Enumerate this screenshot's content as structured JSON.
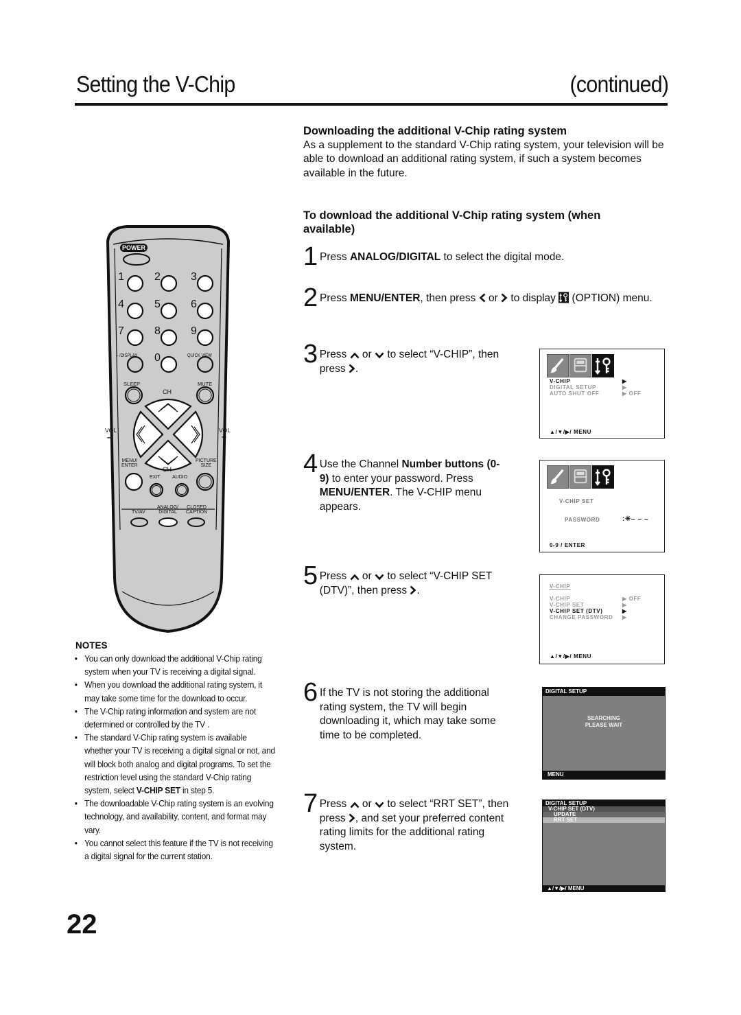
{
  "header": {
    "title": "Setting the V-Chip",
    "continued": "(continued)"
  },
  "section": {
    "heading": "Downloading the additional V-Chip rating system",
    "intro": "As a supplement to the standard V-Chip rating system, your television will be able to download an additional rating system, if such a system becomes available in the future.",
    "subheading": "To download the additional V-Chip rating system (when available)"
  },
  "steps": [
    {
      "num": "1",
      "parts": [
        "Press ",
        "ANALOG/DIGITAL",
        " to select the digital mode."
      ]
    },
    {
      "num": "2",
      "parts": [
        "Press ",
        "MENU/ENTER",
        ", then press ",
        " or ",
        " to display ",
        " (OPTION) menu."
      ]
    },
    {
      "num": "3",
      "parts": [
        "Press ",
        " or ",
        " to select “V-CHIP”, then press ",
        "."
      ]
    },
    {
      "num": "4",
      "parts": [
        "Use the Channel ",
        "Number buttons (0-9)",
        " to enter your password. Press ",
        "MENU/ENTER",
        ". The V-CHIP menu appears."
      ]
    },
    {
      "num": "5",
      "parts": [
        "Press ",
        " or ",
        " to select “V-CHIP SET (DTV)”, then press ",
        "."
      ]
    },
    {
      "num": "6",
      "parts": [
        "If the TV is not storing the additional rating system, the TV will begin downloading it, which may take some time to be completed."
      ]
    },
    {
      "num": "7",
      "parts": [
        "Press ",
        " or ",
        " to select “RRT SET”, then press ",
        ", and set your preferred content rating limits for the additional rating system."
      ]
    }
  ],
  "screens": {
    "option_menu": {
      "items": [
        {
          "label": "V-CHIP",
          "value": "▶",
          "selected": true
        },
        {
          "label": "DIGITAL SETUP",
          "value": "▶",
          "selected": false
        },
        {
          "label": "AUTO SHUT OFF",
          "value": "▶ OFF",
          "selected": false
        }
      ],
      "footer": "▲/▼/▶/ MENU"
    },
    "password_menu": {
      "title": "V-CHIP SET",
      "label": "PASSWORD",
      "value": ":✳– – –",
      "footer": "0-9 / ENTER"
    },
    "vchip_menu": {
      "title": "V-CHIP",
      "items": [
        {
          "label": "V-CHIP",
          "value": "▶ OFF",
          "selected": false
        },
        {
          "label": "V-CHIP SET",
          "value": "▶",
          "selected": false
        },
        {
          "label": "V-CHIP SET (DTV)",
          "value": "▶",
          "selected": true
        },
        {
          "label": "CHANGE PASSWORD",
          "value": "▶",
          "selected": false
        }
      ],
      "footer": "▲/▼/▶/ MENU"
    },
    "searching": {
      "title": "DIGITAL SETUP",
      "line1": "SEARCHING",
      "line2": "PLEASE WAIT",
      "footer": "MENU"
    },
    "rrt": {
      "title": "DIGITAL SETUP",
      "sub": "V-CHIP SET (DTV)",
      "items": [
        "UPDATE",
        "RRT SET"
      ],
      "footer": "▲/▼/▶/ MENU"
    }
  },
  "remote": {
    "power": "POWER",
    "digits": [
      "1",
      "2",
      "3",
      "4",
      "5",
      "6",
      "7",
      "8",
      "9"
    ],
    "zero": "0",
    "display": "– /DISPLAY",
    "quick_view": "QUICK VIEW",
    "sleep": "SLEEP",
    "mute": "MUTE",
    "ch": "CH",
    "vol": "VOL",
    "minus": "–",
    "plus": "+",
    "menu_enter": "MENU/\nENTER",
    "menu": "MENU/",
    "enter": "ENTER",
    "picture": "PICTURE",
    "size": "SIZE",
    "exit": "EXIT",
    "audio": "AUDIO",
    "tvav": "TV/AV",
    "analog": "ANALOG/",
    "digital": "DIGITAL",
    "closed": "CLOSED",
    "caption": "CAPTION"
  },
  "notes": {
    "title": "NOTES",
    "items": [
      "You can only download the additional V-Chip rating system when your TV is receiving a digital signal.",
      "When you download the additional rating system, it may take some time for the download to occur.",
      "The V-Chip rating information and system are not determined or controlled by the TV .",
      "The standard V-Chip rating system is available whether your TV is receiving a digital signal or not, and will block both analog and digital programs. To set the restriction level using the standard V-Chip rating system, select |V-CHIP SET| in step 5.",
      "The downloadable V-Chip rating system is an evolving technology, and availability, content, and format may vary.",
      "You cannot select this feature if the TV is not receiving a digital signal for the current station."
    ]
  },
  "page_number": "22"
}
